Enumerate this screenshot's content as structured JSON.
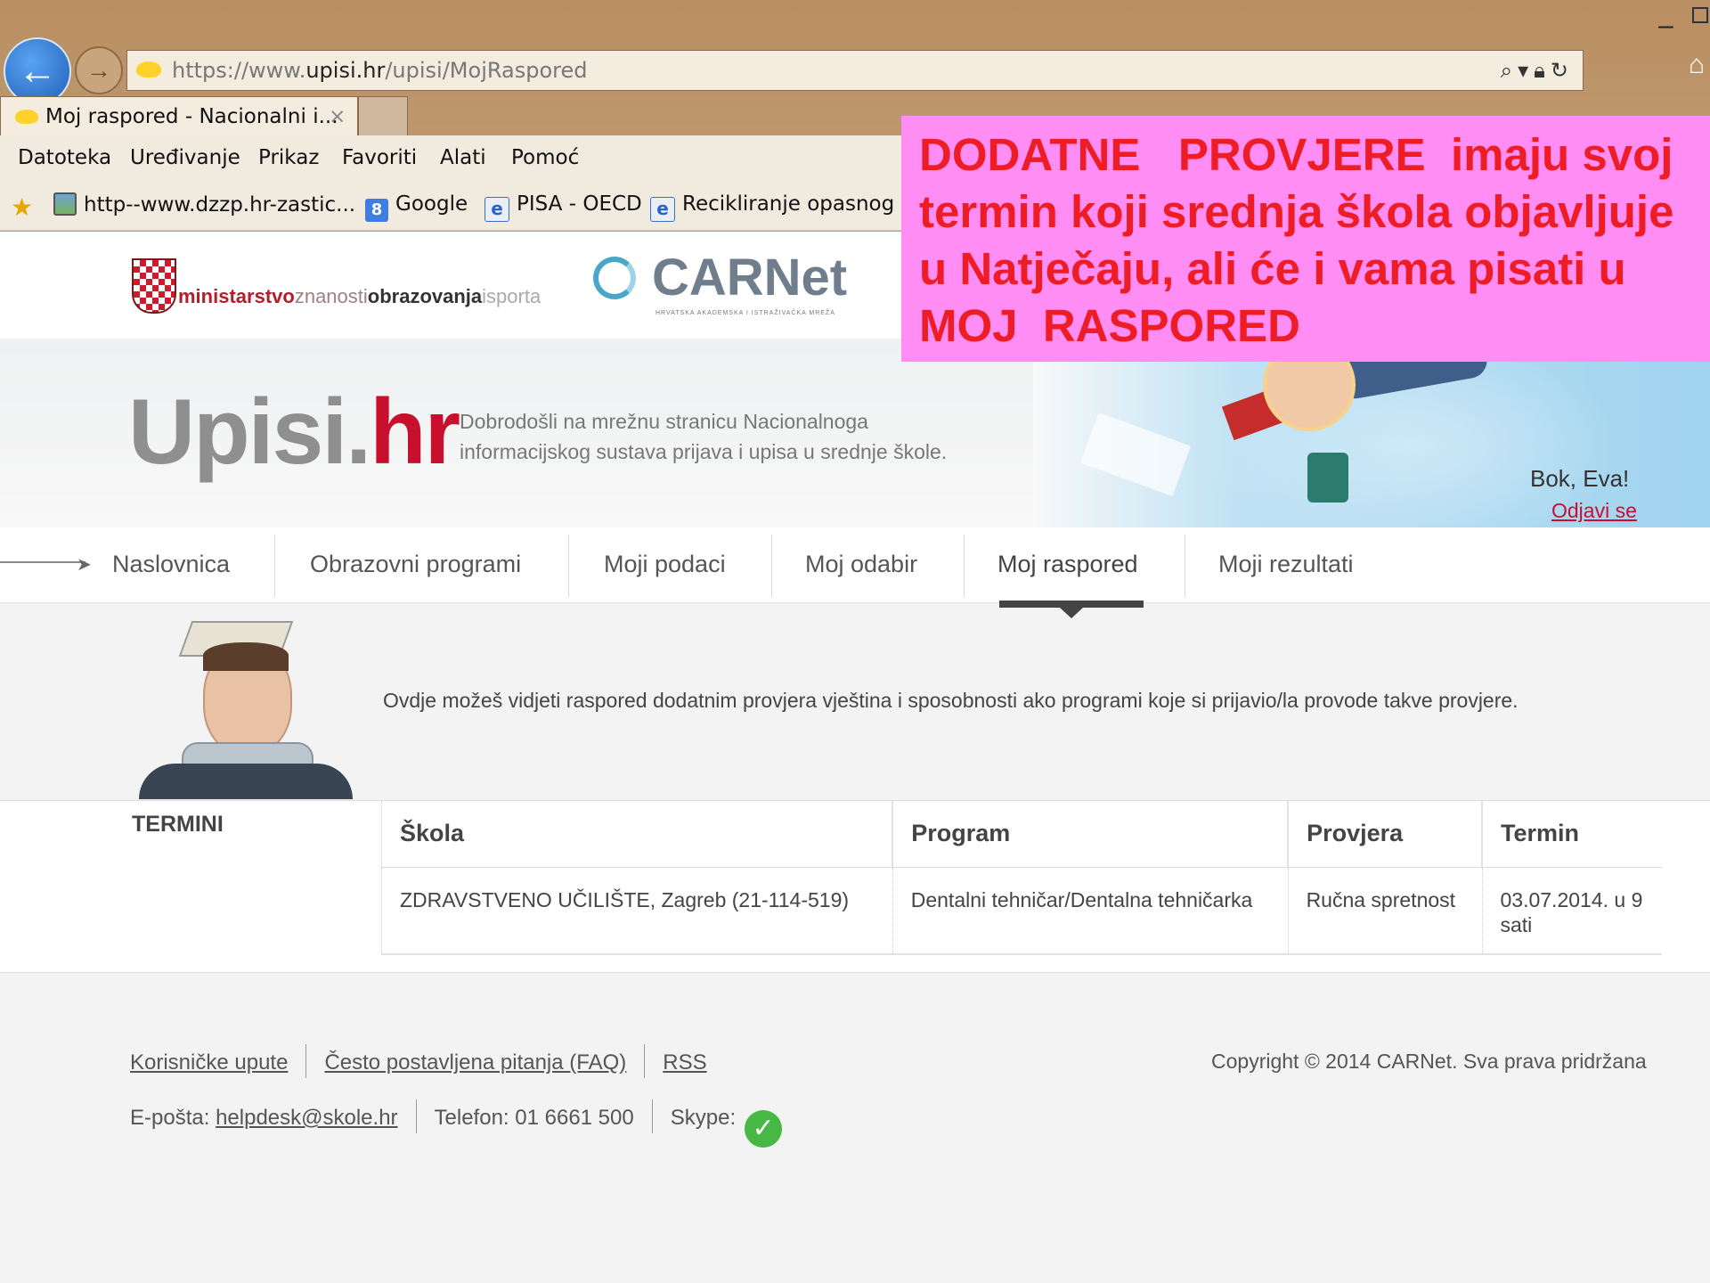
{
  "browser": {
    "url_prefix": "https://www.",
    "url_domain": "upisi.hr",
    "url_path": "/upisi/MojRaspored",
    "tab_title": "Moj raspored - Nacionalni i...",
    "tab_close": "×",
    "menu": [
      "Datoteka",
      "Uređivanje",
      "Prikaz",
      "Favoriti",
      "Alati",
      "Pomoć"
    ],
    "favorites": [
      "http--www.dzzp.hr-zastic...",
      "Google",
      "PISA - OECD",
      "Recikliranje opasnog ot"
    ]
  },
  "logos": {
    "ministry_parts": [
      "ministarstvo",
      "znanosti",
      "obrazovanja",
      "isporta"
    ],
    "carnet": "CARNet",
    "carnet_sub": "HRVATSKA AKADEMSKA I ISTRAŽIVAČKA MREŽA"
  },
  "header": {
    "brand_main": "Upisi.",
    "brand_hr": "hr",
    "tagline": "Dobrodošli na mrežnu stranicu Nacionalnoga informacijskog sustava prijava i upisa u srednje škole.",
    "greeting": "Bok, Eva!",
    "logout": "Odjavi se"
  },
  "nav": {
    "items": [
      "Naslovnica",
      "Obrazovni programi",
      "Moji podaci",
      "Moj odabir",
      "Moj raspored",
      "Moji rezultati"
    ],
    "active": "Moj raspored"
  },
  "intro": {
    "text": "Ovdje možeš vidjeti raspored dodatnim provjera vještina i sposobnosti ako programi koje si prijavio/la provode takve provjere."
  },
  "terms": {
    "label": "TERMINI",
    "headers": [
      "Škola",
      "Program",
      "Provjera",
      "Termin"
    ],
    "rows": [
      [
        "ZDRAVSTVENO UČILIŠTE, Zagreb (21-114-519)",
        "Dentalni tehničar/Dentalna tehničarka",
        "Ručna spretnost",
        "03.07.2014. u 9 sati"
      ]
    ]
  },
  "footer": {
    "links": [
      "Korisničke upute",
      "Često postavljena pitanja (FAQ)",
      "RSS"
    ],
    "copyright": "Copyright © 2014 CARNet. Sva prava pridržana",
    "email_label": "E-pošta:",
    "email": "helpdesk@skole.hr",
    "phone": "Telefon: 01 6661 500",
    "skype_label": "Skype:"
  },
  "callout": {
    "text": "DODATNE   PROVJERE  imaju svoj termin koji srednja škola objavljuje u Natječaju, ali će i vama pisati u MOJ  RASPORED"
  },
  "colors": {
    "callout_bg": "#ff8df3",
    "callout_text": "#ee1c25",
    "brand_red": "#c8102e"
  }
}
